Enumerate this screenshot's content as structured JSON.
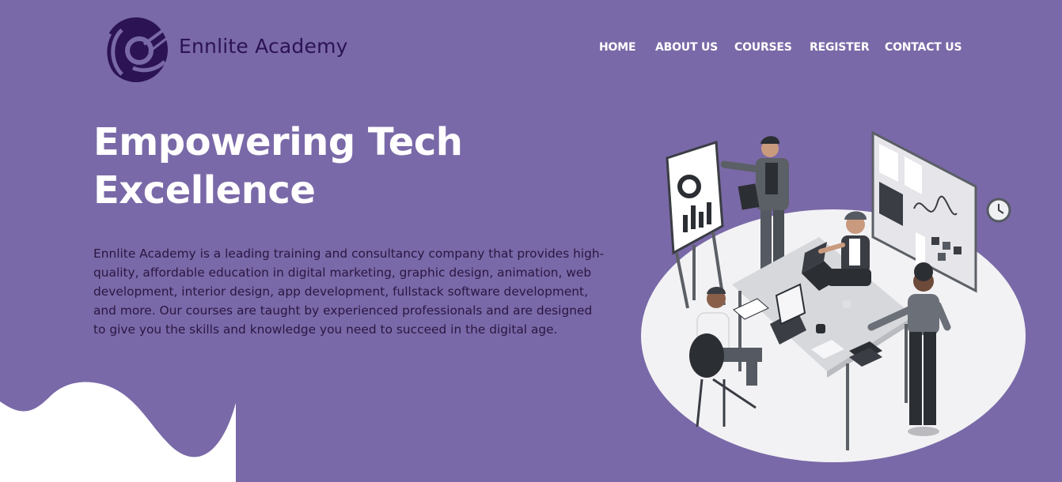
{
  "header": {
    "brand_name": "Ennlite Academy",
    "logo_icon": "ennlite-logo-icon",
    "nav": [
      {
        "label": "HOME"
      },
      {
        "label": "ABOUT US"
      },
      {
        "label": "COURSES"
      },
      {
        "label": "REGISTER"
      },
      {
        "label": "CONTACT US"
      }
    ]
  },
  "hero": {
    "title_line1": "Empowering Tech",
    "title_line2": "Excellence",
    "description": "Ennlite Academy is a leading training and consultancy company that provides high-quality, affordable education in digital marketing, graphic design, animation, web development, interior design, app development, fullstack software development, and more. Our courses are taught by experienced professionals and are designed to give you the skills and knowledge you need to succeed in the digital age.",
    "illustration": "team-meeting-illustration"
  },
  "colors": {
    "background": "#7a69a8",
    "brand_dark": "#2c1353",
    "text_dark": "#2a1642",
    "white": "#ffffff"
  }
}
